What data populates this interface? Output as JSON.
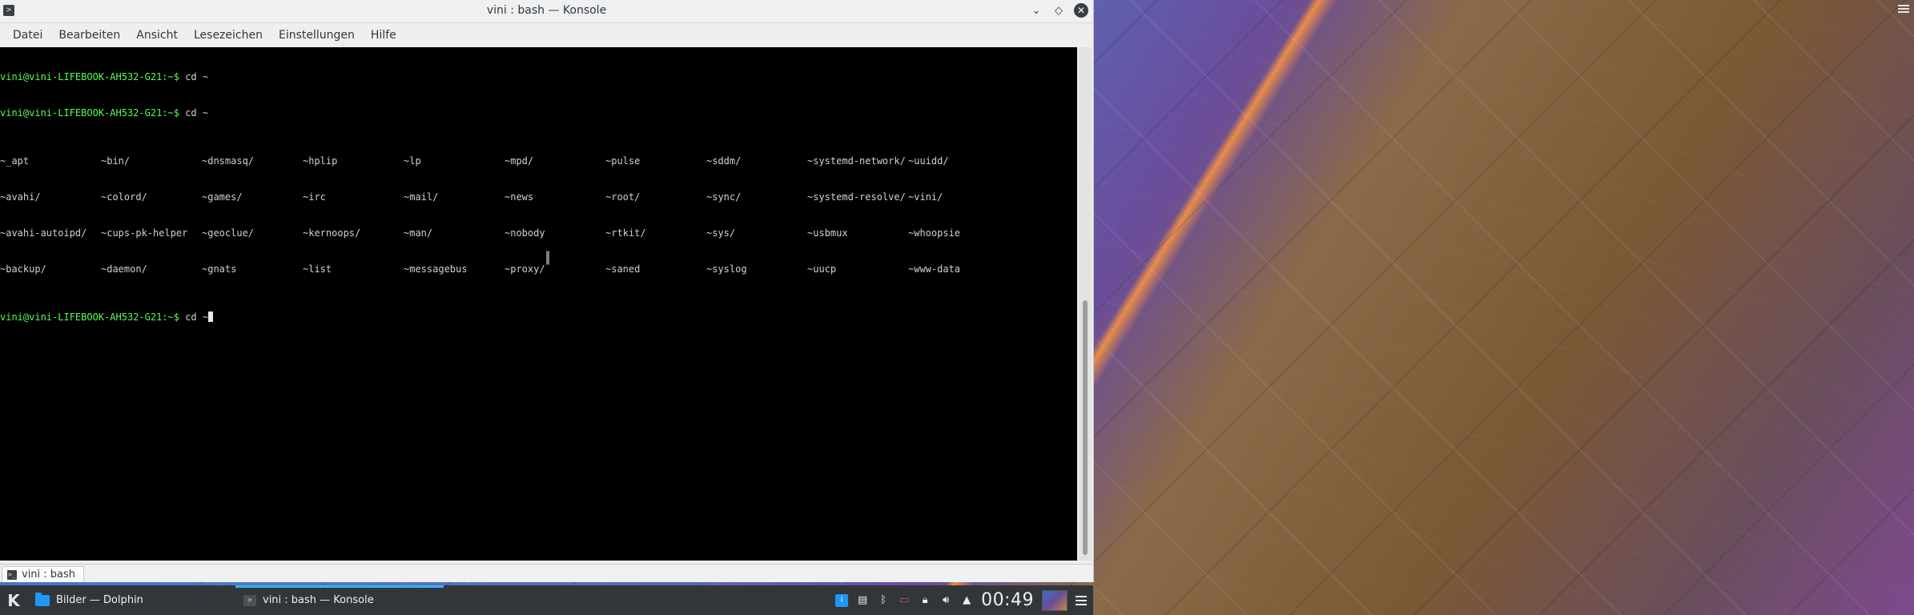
{
  "window": {
    "title": "vini : bash — Konsole",
    "icon_glyph": ">",
    "controls": {
      "minimize_glyph": "⌄",
      "keep_above_glyph": "◇",
      "close_glyph": "✕"
    }
  },
  "menubar": {
    "items": [
      "Datei",
      "Bearbeiten",
      "Ansicht",
      "Lesezeichen",
      "Einstellungen",
      "Hilfe"
    ]
  },
  "terminal": {
    "history": [
      {
        "prompt": "vini@vini-LIFEBOOK-AH532-G21:~$",
        "command": " cd ~"
      },
      {
        "prompt": "vini@vini-LIFEBOOK-AH532-G21:~$",
        "command": " cd ~"
      }
    ],
    "completion_rows": [
      [
        "~_apt",
        "~bin/",
        "~dnsmasq/",
        "~hplip",
        "~lp",
        "~mpd/",
        "~pulse",
        "~sddm/",
        "~systemd-network/",
        "~uuidd/"
      ],
      [
        "~avahi/",
        "~colord/",
        "~games/",
        "~irc",
        "~mail/",
        "~news",
        "~root/",
        "~sync/",
        "~systemd-resolve/",
        "~vini/"
      ],
      [
        "~avahi-autoipd/",
        "~cups-pk-helper",
        "~geoclue/",
        "~kernoops/",
        "~man/",
        "~nobody",
        "~rtkit/",
        "~sys/",
        "~usbmux",
        "~whoopsie"
      ],
      [
        "~backup/",
        "~daemon/",
        "~gnats",
        "~list",
        "~messagebus",
        "~proxy/",
        "~saned",
        "~syslog",
        "~uucp",
        "~www-data"
      ]
    ],
    "current": {
      "prompt": "vini@vini-LIFEBOOK-AH532-G21:~$",
      "command": " cd ~"
    }
  },
  "tabs": [
    {
      "label": "vini : bash",
      "icon": "terminal-icon"
    }
  ],
  "taskbar": {
    "launcher_glyph": "K",
    "tasks": [
      {
        "label": "Bilder — Dolphin",
        "icon": "folder-icon",
        "active": false
      },
      {
        "label": "vini : bash — Konsole",
        "icon": "konsole-icon",
        "active": true
      }
    ],
    "tray": {
      "clock": "00:49",
      "icons": [
        "info-icon",
        "clipboard-icon",
        "bluetooth-icon",
        "battery-icon",
        "lock-icon",
        "volume-icon",
        "expand-arrow-icon"
      ]
    }
  },
  "colors": {
    "prompt_green": "#54ff54",
    "panel_bg": "#31363b",
    "accent_blue": "#3daee9"
  }
}
